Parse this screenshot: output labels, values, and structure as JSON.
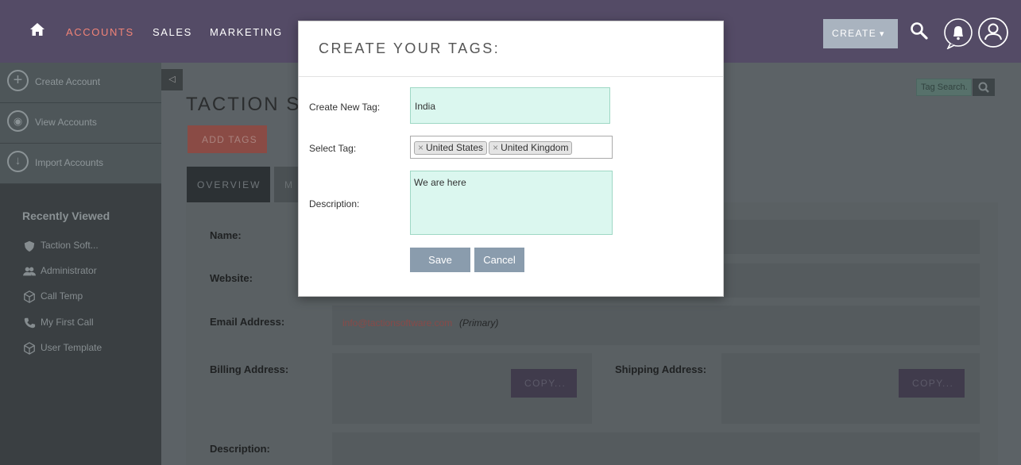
{
  "nav": {
    "items": [
      "ACCOUNTS",
      "SALES",
      "MARKETING"
    ],
    "create_label": "CREATE",
    "create_caret": "▾"
  },
  "sidebar": {
    "actions": [
      "Create Account",
      "View Accounts",
      "Import Accounts"
    ],
    "action_icons": [
      "plus-icon",
      "eye-icon",
      "download-icon"
    ],
    "recent_title": "Recently Viewed",
    "recent": [
      {
        "label": "Taction Soft...",
        "icon": "shield-icon"
      },
      {
        "label": "Administrator",
        "icon": "users-icon"
      },
      {
        "label": "Call Temp",
        "icon": "cube-icon"
      },
      {
        "label": "My First Call",
        "icon": "phone-icon"
      },
      {
        "label": "User Template",
        "icon": "cube-icon"
      }
    ]
  },
  "main": {
    "title": "TACTION SO",
    "add_tags_label": "ADD TAGS",
    "tabs": [
      "OVERVIEW",
      "M"
    ],
    "tag_search_placeholder": "Tag Search.",
    "fields": {
      "name": "Name:",
      "website": "Website:",
      "email": "Email Address:",
      "email_value": "info@tactionsoftware.com",
      "email_primary": "(Primary)",
      "billing": "Billing Address:",
      "shipping": "Shipping Address:",
      "description": "Description:",
      "copy_label": "COPY..."
    }
  },
  "modal": {
    "title": "CREATE YOUR TAGS:",
    "create_label": "Create New Tag:",
    "create_value": "India",
    "select_label": "Select Tag:",
    "selected_tags": [
      "United States",
      "United Kingdom"
    ],
    "remove_symbol": "×",
    "description_label": "Description:",
    "description_value": "We are here",
    "save_label": "Save",
    "cancel_label": "Cancel"
  },
  "colors": {
    "nav_bg": "#544b66",
    "nav_active": "#f08377",
    "input_bg": "#dbf7ef",
    "button_bg": "#8a9cad"
  }
}
